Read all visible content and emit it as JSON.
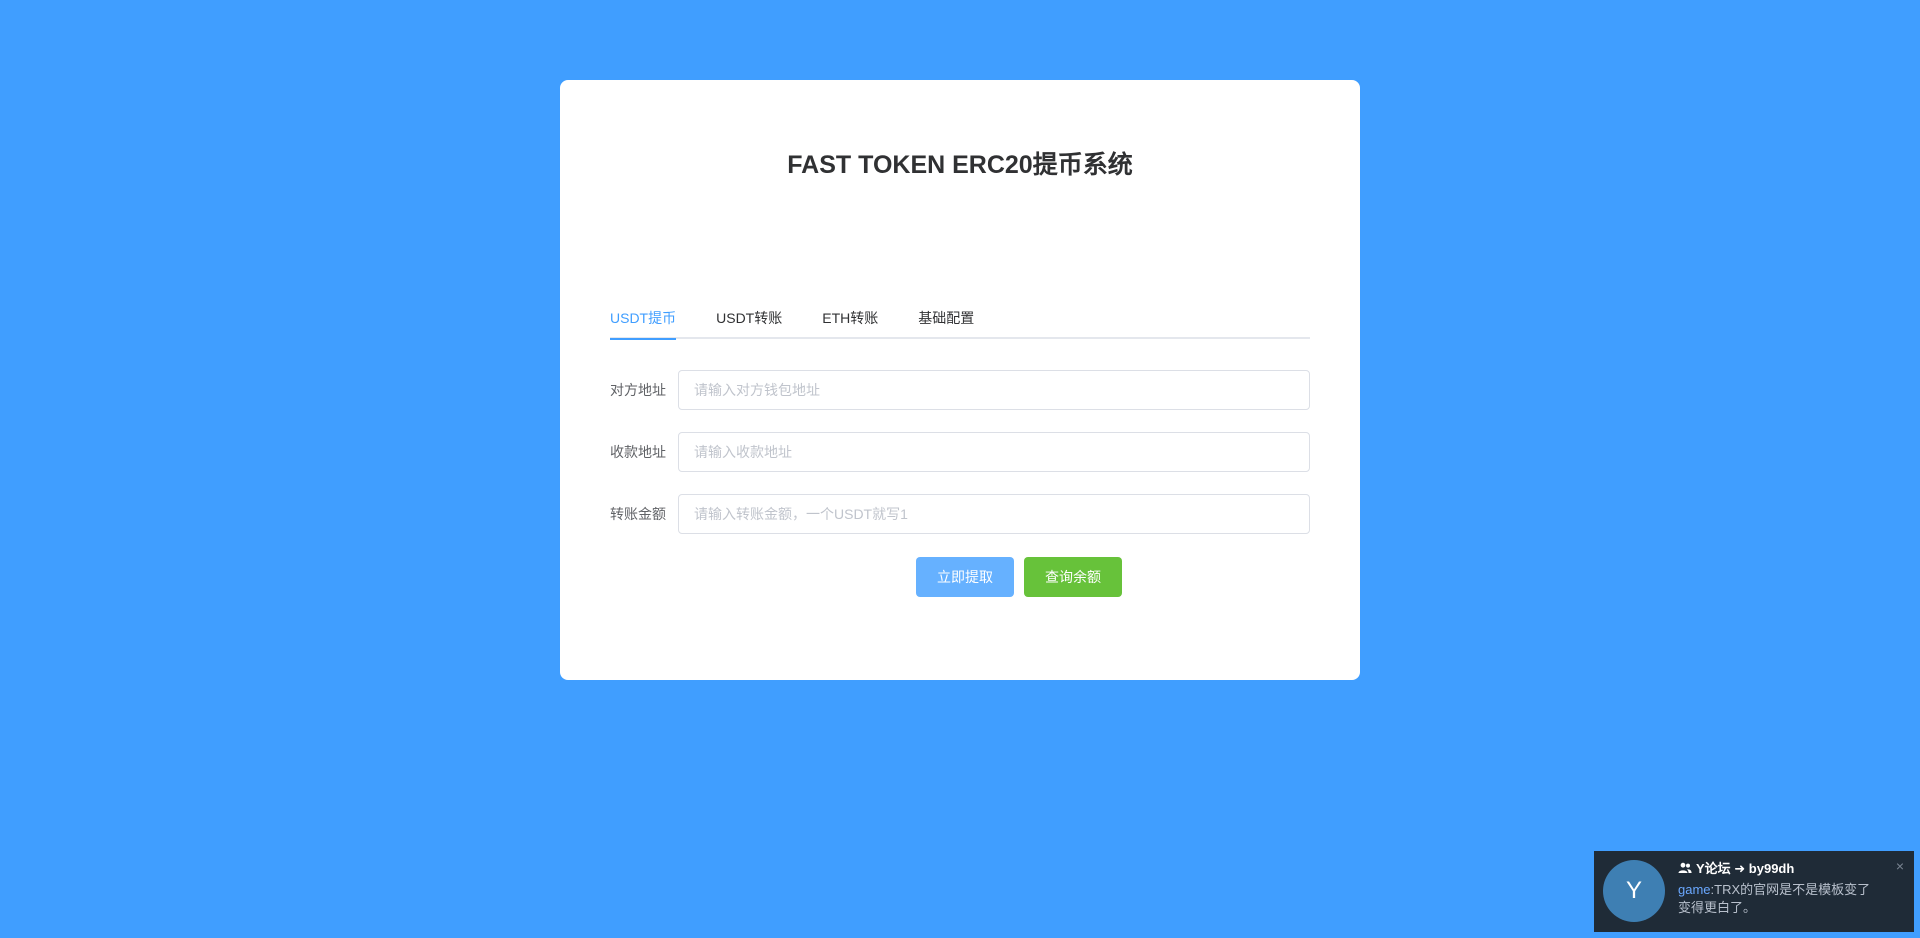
{
  "page": {
    "title": "FAST TOKEN ERC20提币系统"
  },
  "tabs": [
    {
      "label": "USDT提币",
      "active": true
    },
    {
      "label": "USDT转账",
      "active": false
    },
    {
      "label": "ETH转账",
      "active": false
    },
    {
      "label": "基础配置",
      "active": false
    }
  ],
  "form": {
    "from_address": {
      "label": "对方地址",
      "placeholder": "请输入对方钱包地址",
      "value": ""
    },
    "to_address": {
      "label": "收款地址",
      "placeholder": "请输入收款地址",
      "value": ""
    },
    "amount": {
      "label": "转账金额",
      "placeholder": "请输入转账金额，一个USDT就写1",
      "value": ""
    }
  },
  "buttons": {
    "withdraw": "立即提取",
    "check_balance": "查询余额"
  },
  "notification": {
    "avatar_letter": "Y",
    "header_icon": "users-icon",
    "header": "Y论坛 ➜ by99dh",
    "user": "game",
    "separator": ":",
    "message": "TRX的官网是不是模板变了变得更白了。",
    "close": "×"
  },
  "colors": {
    "background": "#409eff",
    "primary_button": "#66b1ff",
    "success_button": "#67c23a",
    "active_tab": "#409eff",
    "notification_bg": "#1f2b37"
  }
}
